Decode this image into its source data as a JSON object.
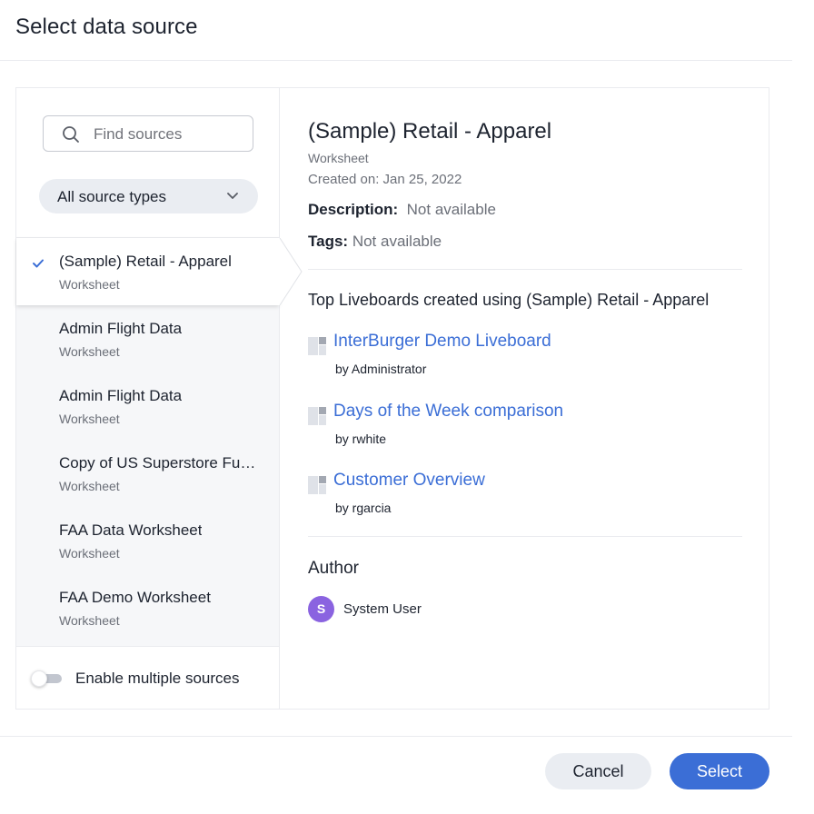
{
  "dialog": {
    "title": "Select data source"
  },
  "sidebar": {
    "search": {
      "placeholder": "Find sources",
      "value": ""
    },
    "type_filter": {
      "selected": "All source types"
    },
    "sources": [
      {
        "name": "(Sample) Retail - Apparel",
        "type": "Worksheet",
        "selected": true
      },
      {
        "name": "Admin Flight Data",
        "type": "Worksheet",
        "selected": false
      },
      {
        "name": "Admin Flight Data",
        "type": "Worksheet",
        "selected": false
      },
      {
        "name": "Copy of US Superstore Fu…",
        "type": "Worksheet",
        "selected": false
      },
      {
        "name": "FAA Data Worksheet",
        "type": "Worksheet",
        "selected": false
      },
      {
        "name": "FAA Demo Worksheet",
        "type": "Worksheet",
        "selected": false
      }
    ],
    "multi_toggle": {
      "label": "Enable multiple sources",
      "on": false
    }
  },
  "details": {
    "title": "(Sample) Retail - Apparel",
    "type": "Worksheet",
    "created": "Created on: Jan 25, 2022",
    "description_label": "Description:",
    "description_value": "Not available",
    "tags_label": "Tags:",
    "tags_value": "Not available",
    "liveboards_heading": "Top Liveboards created using (Sample) Retail - Apparel",
    "liveboards": [
      {
        "name": "InterBurger Demo Liveboard",
        "author": "by Administrator"
      },
      {
        "name": "Days of the Week comparison",
        "author": "by rwhite"
      },
      {
        "name": "Customer Overview",
        "author": "by rgarcia"
      }
    ],
    "author_heading": "Author",
    "author": {
      "initial": "S",
      "name": "System User"
    }
  },
  "footer": {
    "cancel_label": "Cancel",
    "select_label": "Select"
  },
  "colors": {
    "accent": "#3b6ed6",
    "avatar": "#8a63e0",
    "list_bg": "#f6f7f9"
  }
}
